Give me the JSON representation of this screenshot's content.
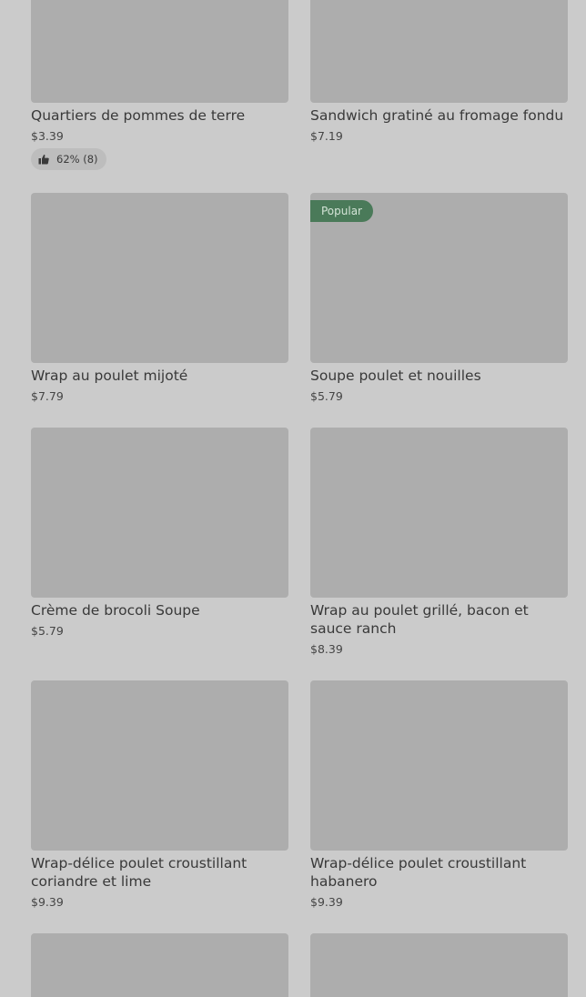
{
  "menu": {
    "items": [
      {
        "name": "Quartiers de pommes de terre",
        "price": "$3.39",
        "rating": "62% (8)"
      },
      {
        "name": "Sandwich gratiné au fromage fondu",
        "price": "$7.19"
      },
      {
        "name": "Wrap au poulet mijoté",
        "price": "$7.79"
      },
      {
        "name": "Soupe poulet et nouilles",
        "price": "$5.79",
        "badge": "Popular"
      },
      {
        "name": "Crème de brocoli Soupe",
        "price": "$5.79"
      },
      {
        "name": "Wrap au poulet grillé, bacon et sauce ranch",
        "price": "$8.39"
      },
      {
        "name": "Wrap-délice poulet croustillant coriandre et lime",
        "price": "$9.39"
      },
      {
        "name": "Wrap-délice poulet croustillant habanero",
        "price": "$9.39"
      }
    ]
  },
  "colors": {
    "background": "#cbcbcb",
    "image_placeholder": "#adadad",
    "badge": "#4a7a59",
    "text": "#393939"
  },
  "icons": {
    "rating": "thumbs-up-icon"
  }
}
